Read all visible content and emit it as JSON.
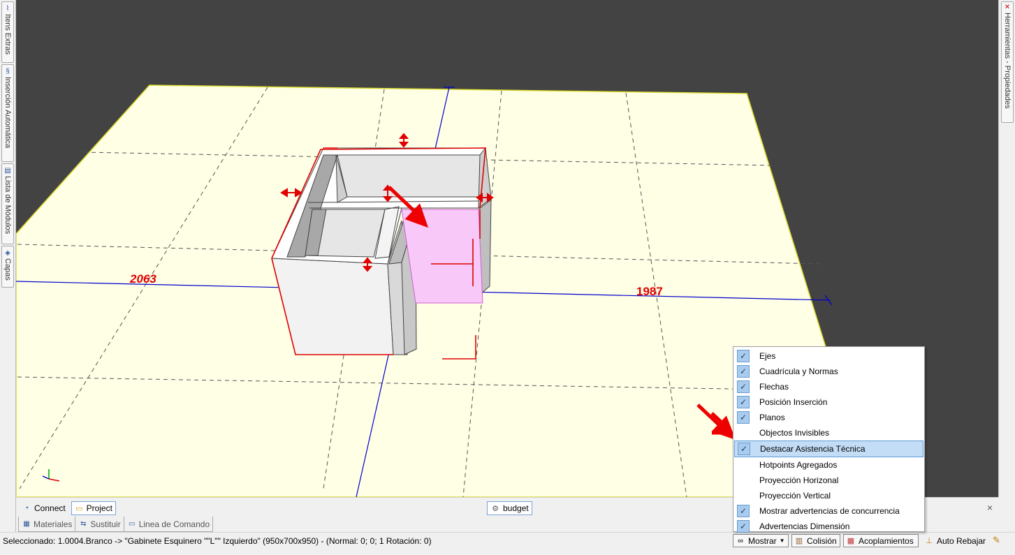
{
  "left_tabs": [
    {
      "label": "Itens Extras",
      "icon": "paperclip-icon",
      "glyph": "⌇"
    },
    {
      "label": "Inserción Automática",
      "icon": "links-icon",
      "glyph": "§"
    },
    {
      "label": "Lista de Módulos",
      "icon": "list-icon",
      "glyph": "▤"
    },
    {
      "label": "Capas",
      "icon": "layers-icon",
      "glyph": "◈"
    }
  ],
  "right_tab": {
    "label": "Herramientas - Propiedades",
    "icon": "tools-icon",
    "glyph": "✕"
  },
  "viewport": {
    "dimension_left": "2063",
    "dimension_right": "1987",
    "colors": {
      "background": "#434343",
      "floor": "#ffffe6",
      "highlight": "#f8c8f8",
      "dimension": "#e00000",
      "axis": "#0000cc"
    }
  },
  "tabbar": {
    "connect": "Connect",
    "project": "Project",
    "budget": "budget",
    "close": "×"
  },
  "bottom_tabs": [
    {
      "label": "Materiales",
      "icon": "materials-icon",
      "glyph": "▦"
    },
    {
      "label": "Sustituir",
      "icon": "replace-icon",
      "glyph": "⇆"
    },
    {
      "label": "Linea de Comando",
      "icon": "command-line-icon",
      "glyph": "▭"
    }
  ],
  "status": {
    "selected_text": "Seleccionado: 1.0004.Branco -> \"Gabinete Esquinero \"\"L\"\" Izquierdo\" (950x700x950) - (Normal: 0; 0; 1 Rotación: 0)",
    "mostrar": "Mostrar",
    "colision": "Colisión",
    "acoplamientos": "Acoplamientos",
    "auto_rebajar": "Auto Rebajar"
  },
  "menu": [
    {
      "label": "Ejes",
      "checked": true
    },
    {
      "label": "Cuadrícula y Normas",
      "checked": true
    },
    {
      "label": "Flechas",
      "checked": true
    },
    {
      "label": "Posición Inserción",
      "checked": true
    },
    {
      "label": "Planos",
      "checked": true
    },
    {
      "label": "Objectos Invisibles",
      "checked": false
    },
    {
      "label": "Destacar Asistencia Técnica",
      "checked": true,
      "highlighted": true
    },
    {
      "label": "Hotpoints Agregados",
      "checked": false
    },
    {
      "label": "Proyección Horizonal",
      "checked": false
    },
    {
      "label": "Proyección Vertical",
      "checked": false
    },
    {
      "label": "Mostrar advertencias de concurrencia",
      "checked": true
    },
    {
      "label": "Advertencias Dimensión",
      "checked": true
    }
  ]
}
